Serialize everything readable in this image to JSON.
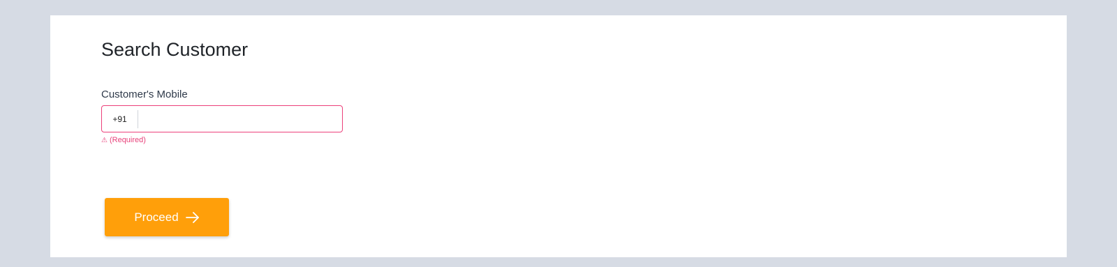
{
  "page": {
    "title": "Search Customer"
  },
  "form": {
    "mobile_label": "Customer's Mobile",
    "country_code": "+91",
    "mobile_value": "",
    "error_icon": "⚠",
    "error_text": "(Required)"
  },
  "actions": {
    "proceed_label": "Proceed",
    "proceed_icon": "arrow-right-icon"
  },
  "colors": {
    "background": "#d6dbe4",
    "card": "#ffffff",
    "error": "#ec407a",
    "primary_button": "#ff9f0a"
  }
}
